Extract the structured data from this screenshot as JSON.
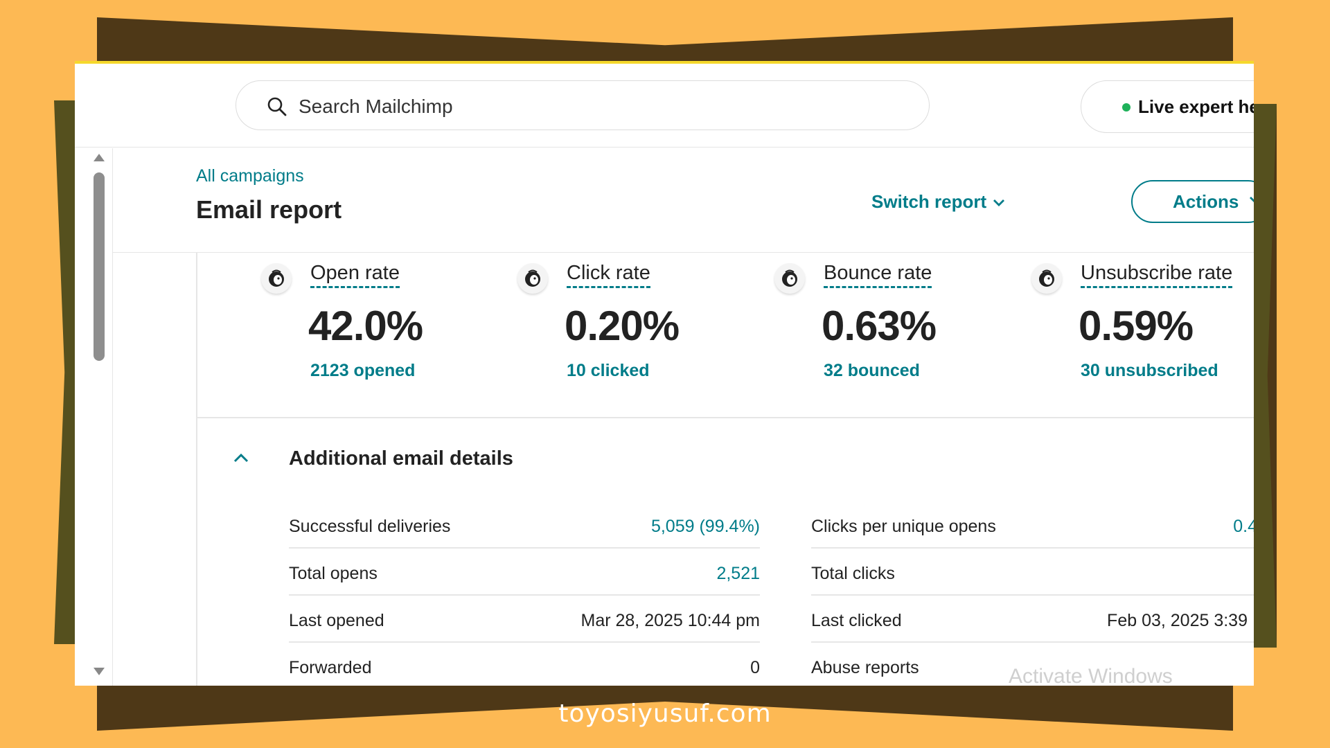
{
  "search": {
    "placeholder": "Search Mailchimp"
  },
  "live_help": {
    "label": "Live expert he"
  },
  "header": {
    "breadcrumb": "All campaigns",
    "title": "Email report",
    "switch_report": "Switch report",
    "actions": "Actions"
  },
  "stats": [
    {
      "label": "Open rate",
      "value": "42.0%",
      "sub": "2123 opened",
      "icon": "mailchimp-freddie-icon"
    },
    {
      "label": "Click rate",
      "value": "0.20%",
      "sub": "10 clicked",
      "icon": "mailchimp-freddie-icon"
    },
    {
      "label": "Bounce rate",
      "value": "0.63%",
      "sub": "32 bounced",
      "icon": "mailchimp-freddie-icon"
    },
    {
      "label": "Unsubscribe rate",
      "value": "0.59%",
      "sub": "30 unsubscribed",
      "icon": "mailchimp-freddie-icon"
    }
  ],
  "details": {
    "title": "Additional email details",
    "left": [
      {
        "label": "Successful deliveries",
        "value": "5,059 (99.4%)"
      },
      {
        "label": "Total opens",
        "value": "2,521"
      },
      {
        "label": "Last opened",
        "value": "Mar 28, 2025 10:44 pm"
      },
      {
        "label": "Forwarded",
        "value": "0"
      }
    ],
    "right": [
      {
        "label": "Clicks per unique opens",
        "value": "0.4"
      },
      {
        "label": "Total clicks",
        "value": ""
      },
      {
        "label": "Last clicked",
        "value": "Feb 03, 2025 3:39"
      },
      {
        "label": "Abuse reports",
        "value": ""
      }
    ]
  },
  "watermark": "Activate Windows",
  "footer": "toyosiyusuf.com",
  "colors": {
    "accent": "#007C89",
    "background": "#FDB954",
    "frame_dark": "#4E3817",
    "live_dot": "#1EB15A"
  }
}
